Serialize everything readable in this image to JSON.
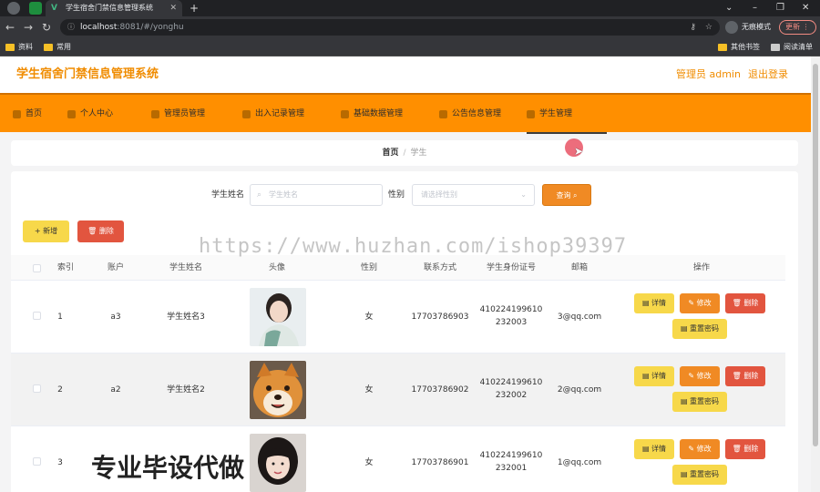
{
  "browser": {
    "tab_title": "学生宿舍门禁信息管理系统",
    "url_host": "localhost",
    "url_path": ":8081/#/yonghu",
    "incognito_label": "无痕模式",
    "update_label": "更新",
    "bookmarks": [
      "资料",
      "常用"
    ],
    "bookmarks_right": [
      "其他书签",
      "阅读清单"
    ]
  },
  "header": {
    "title": "学生宿舍门禁信息管理系统",
    "user_label": "管理员 admin",
    "logout_label": "退出登录",
    "accent_color": "#f08c00"
  },
  "menu": {
    "items": [
      {
        "label": "首页"
      },
      {
        "label": "个人中心"
      },
      {
        "label": "管理员管理"
      },
      {
        "label": "出入记录管理"
      },
      {
        "label": "基础数据管理"
      },
      {
        "label": "公告信息管理"
      },
      {
        "label": "学生管理"
      }
    ],
    "active_index": 6,
    "bar_color": "#ff8f00"
  },
  "breadcrumb": {
    "home": "首页",
    "sep": "/",
    "current": "学生"
  },
  "search": {
    "name_label": "学生姓名",
    "name_placeholder": "学生姓名",
    "gender_label": "性别",
    "gender_placeholder": "请选择性别",
    "query_label": "查询"
  },
  "actions": {
    "add_label": "新增",
    "delete_label": "删除"
  },
  "table": {
    "columns": [
      "索引",
      "账户",
      "学生姓名",
      "头像",
      "性别",
      "联系方式",
      "学生身份证号",
      "邮箱",
      "操作"
    ],
    "rows": [
      {
        "index": "1",
        "account": "a3",
        "name": "学生姓名3",
        "avatar": "woman-portrait",
        "gender": "女",
        "phone": "17703786903",
        "id_line1": "410224199610",
        "id_line2": "232003",
        "email": "3@qq.com"
      },
      {
        "index": "2",
        "account": "a2",
        "name": "学生姓名2",
        "avatar": "shiba-dog",
        "gender": "女",
        "phone": "17703786902",
        "id_line1": "410224199610",
        "id_line2": "232002",
        "email": "2@qq.com"
      },
      {
        "index": "3",
        "account": "",
        "name": "",
        "avatar": "girl-portrait",
        "gender": "女",
        "phone": "17703786901",
        "id_line1": "410224199610",
        "id_line2": "232001",
        "email": "1@qq.com"
      }
    ],
    "row_actions": {
      "detail": "详情",
      "edit": "修改",
      "delete": "删除",
      "reset": "重置密码"
    }
  },
  "overlays": {
    "watermark": "https://www.huzhan.com/ishop39397",
    "promo": "专业毕设代做"
  }
}
